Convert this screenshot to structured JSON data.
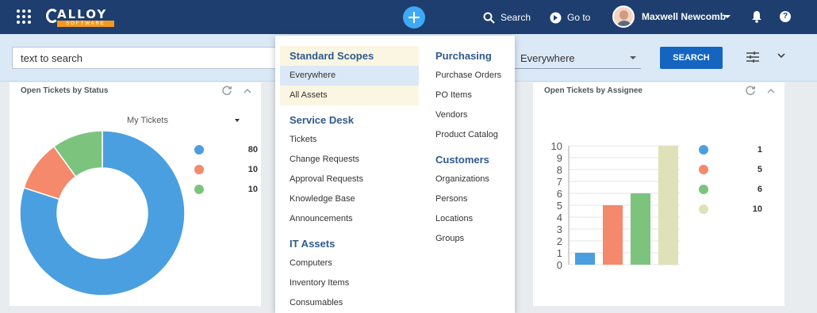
{
  "header": {
    "logo_main": "ALLOY",
    "logo_sub": "SOFTWARE",
    "search_label": "Search",
    "goto_label": "Go to",
    "user_name": "Maxwell Newcomb"
  },
  "searchbar": {
    "input_value": "text to search",
    "scope_value": "Everywhere",
    "search_button": "SEARCH"
  },
  "menu": {
    "col1": [
      {
        "type": "heading",
        "label": "Standard Scopes",
        "hl": "cream"
      },
      {
        "type": "item",
        "label": "Everywhere",
        "hl": "blue"
      },
      {
        "type": "item",
        "label": "All Assets",
        "hl": "cream"
      },
      {
        "type": "heading",
        "label": "Service Desk"
      },
      {
        "type": "item",
        "label": "Tickets"
      },
      {
        "type": "item",
        "label": "Change Requests"
      },
      {
        "type": "item",
        "label": "Approval Requests"
      },
      {
        "type": "item",
        "label": "Knowledge Base"
      },
      {
        "type": "item",
        "label": "Announcements"
      },
      {
        "type": "heading",
        "label": "IT Assets"
      },
      {
        "type": "item",
        "label": "Computers"
      },
      {
        "type": "item",
        "label": "Inventory Items"
      },
      {
        "type": "item",
        "label": "Consumables"
      }
    ],
    "col2": [
      {
        "type": "heading",
        "label": "Purchasing"
      },
      {
        "type": "item",
        "label": "Purchase Orders"
      },
      {
        "type": "item",
        "label": "PO Items"
      },
      {
        "type": "item",
        "label": "Vendors"
      },
      {
        "type": "item",
        "label": "Product Catalog"
      },
      {
        "type": "heading",
        "label": "Customers"
      },
      {
        "type": "item",
        "label": "Organizations"
      },
      {
        "type": "item",
        "label": "Persons"
      },
      {
        "type": "item",
        "label": "Locations"
      },
      {
        "type": "item",
        "label": "Groups"
      }
    ]
  },
  "left_widget": {
    "title": "Open Tickets by Status",
    "filter": "My Tickets"
  },
  "right_widget": {
    "title": "Open Tickets by Assignee"
  },
  "chart_data": [
    {
      "type": "pie",
      "values": [
        80,
        10,
        10
      ],
      "colors": [
        "#4a9fe0",
        "#f4896b",
        "#7cc47e"
      ]
    },
    {
      "type": "bar",
      "values": [
        1,
        5,
        6,
        10
      ],
      "colors": [
        "#4a9fe0",
        "#f4896b",
        "#7cc47e",
        "#dfe2b8"
      ],
      "ylim": [
        0,
        10
      ],
      "yticks": [
        0,
        1,
        2,
        3,
        4,
        5,
        6,
        7,
        8,
        9,
        10
      ],
      "grid": true
    }
  ]
}
